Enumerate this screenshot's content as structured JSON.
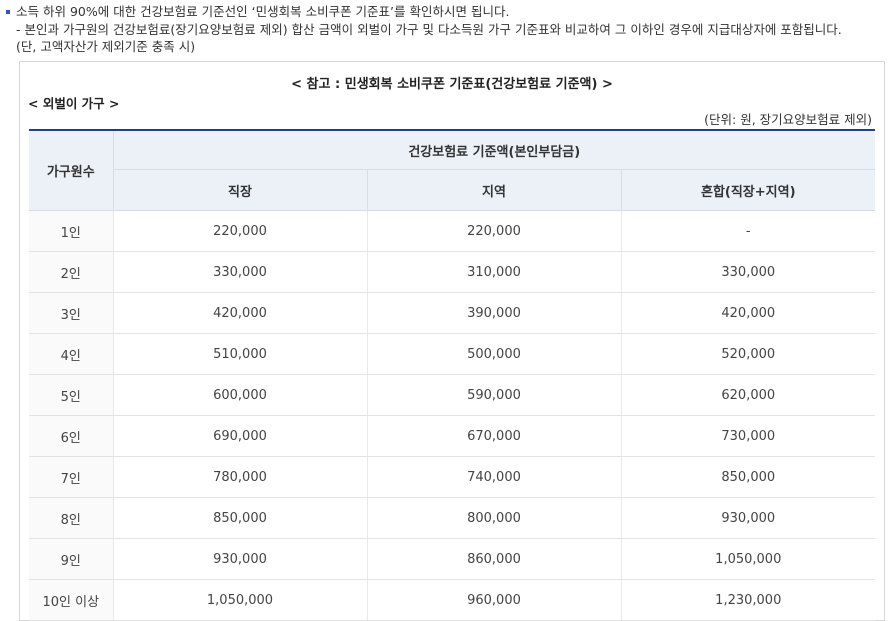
{
  "intro": {
    "line1": "소득 하위 90%에 대한 건강보험료 기준선인 ‘민생회복 소비쿠폰 기준표’를 확인하시면 됩니다.",
    "line2": "- 본인과 가구원의 건강보험료(장기요양보험료 제외) 합산 금액이 외벌이 가구 및 다소득원 가구 기준표와 비교하여 그 이하인 경우에 지급대상자에 포함됩니다.",
    "line3": "(단, 고액자산가 제외기준 충족 시)"
  },
  "box": {
    "title": "< 참고 : 민생회복 소비쿠폰 기준표(건강보험료 기준액) >",
    "subtitle": "< 외벌이 가구 >",
    "unit": "(단위: 원, 장기요양보험료 제외)"
  },
  "table": {
    "col_household": "가구원수",
    "col_group": "건강보험료 기준액(본인부담금)",
    "col_work": "직장",
    "col_region": "지역",
    "col_mixed": "혼합(직장+지역)",
    "rows": [
      {
        "size": "1인",
        "work": "220,000",
        "region": "220,000",
        "mixed": "-"
      },
      {
        "size": "2인",
        "work": "330,000",
        "region": "310,000",
        "mixed": "330,000"
      },
      {
        "size": "3인",
        "work": "420,000",
        "region": "390,000",
        "mixed": "420,000"
      },
      {
        "size": "4인",
        "work": "510,000",
        "region": "500,000",
        "mixed": "520,000"
      },
      {
        "size": "5인",
        "work": "600,000",
        "region": "590,000",
        "mixed": "620,000"
      },
      {
        "size": "6인",
        "work": "690,000",
        "region": "670,000",
        "mixed": "730,000"
      },
      {
        "size": "7인",
        "work": "780,000",
        "region": "740,000",
        "mixed": "850,000"
      },
      {
        "size": "8인",
        "work": "850,000",
        "region": "800,000",
        "mixed": "930,000"
      },
      {
        "size": "9인",
        "work": "930,000",
        "region": "860,000",
        "mixed": "1,050,000"
      },
      {
        "size": "10인 이상",
        "work": "1,050,000",
        "region": "960,000",
        "mixed": "1,230,000"
      }
    ]
  }
}
